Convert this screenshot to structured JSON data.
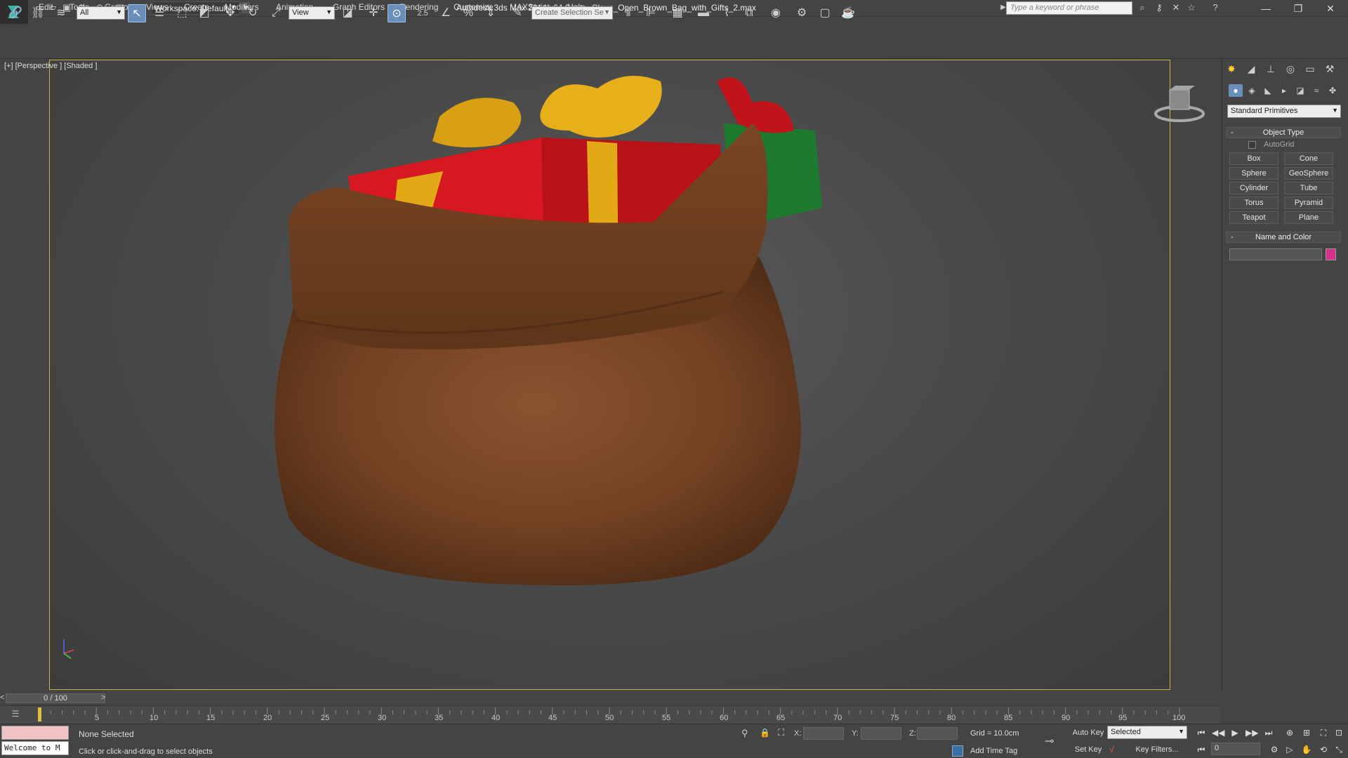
{
  "titlebar": {
    "workspace": "Workspace: Default",
    "title": "Autodesk 3ds Max  2014 x64     Santa_Claus_Open_Brown_Bag_with_Gifts_2.max",
    "search_placeholder": "Type a keyword or phrase"
  },
  "menu": [
    "Edit",
    "Tools",
    "Group",
    "Views",
    "Create",
    "Modifiers",
    "Animation",
    "Graph Editors",
    "Rendering",
    "Customize",
    "MAXScript",
    "Help"
  ],
  "toolbar": {
    "filter_value": "All",
    "refcoord_value": "View",
    "snap_value": "2.5",
    "selection_set_placeholder": "Create Selection Se"
  },
  "viewport": {
    "label": "[+] [Perspective ] [Shaded ]",
    "accent_color": "#c8b43a"
  },
  "command_panel": {
    "dropdown": "Standard Primitives",
    "object_type_title": "Object Type",
    "autogrid": "AutoGrid",
    "buttons": [
      "Box",
      "Cone",
      "Sphere",
      "GeoSphere",
      "Cylinder",
      "Tube",
      "Torus",
      "Pyramid",
      "Teapot",
      "Plane"
    ],
    "name_color_title": "Name and Color",
    "swatch_color": "#d6308a"
  },
  "timeline": {
    "slider_text": "0 / 100",
    "ticks": [
      "5",
      "10",
      "15",
      "20",
      "25",
      "30",
      "35",
      "40",
      "45",
      "50",
      "55",
      "60",
      "65",
      "70",
      "75",
      "80",
      "85",
      "90",
      "95",
      "100"
    ]
  },
  "status": {
    "listener_text": "Welcome to M",
    "selection": "None Selected",
    "prompt": "Click or click-and-drag to select objects",
    "x_label": "X:",
    "y_label": "Y:",
    "z_label": "Z:",
    "grid": "Grid = 10.0cm",
    "add_time_tag": "Add Time Tag",
    "auto_key": "Auto Key",
    "set_key": "Set Key",
    "selected_value": "Selected",
    "key_filters": "Key Filters...",
    "frame_value": "0"
  }
}
